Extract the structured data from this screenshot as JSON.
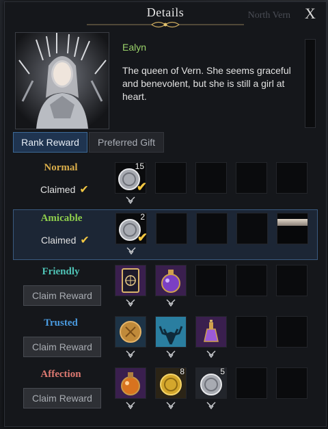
{
  "window": {
    "title": "Details",
    "background_label": "North Vern",
    "close_label": "X"
  },
  "character": {
    "name": "Ealyn",
    "description": "The queen of Vern. She seems graceful and benevolent, but she is still a girl at heart."
  },
  "tabs": [
    {
      "label": "Rank Reward",
      "active": true
    },
    {
      "label": "Preferred Gift",
      "active": false
    }
  ],
  "rows": [
    {
      "rank": "Normal",
      "color": "#d9ad4a",
      "status": "Claimed",
      "claimed": true,
      "rewards": [
        {
          "icon": "silver-coin-icon",
          "qty": "15",
          "claimed": true
        }
      ]
    },
    {
      "rank": "Amicable",
      "color": "#8fcf4c",
      "status": "Claimed",
      "claimed": true,
      "highlighted": true,
      "rewards": [
        {
          "icon": "silver-coin-icon",
          "qty": "2",
          "claimed": true
        }
      ]
    },
    {
      "rank": "Friendly",
      "color": "#4fc3b6",
      "status": "Claim Reward",
      "claimed": false,
      "rewards": [
        {
          "icon": "card-icon",
          "qty": ""
        },
        {
          "icon": "purple-potion-icon",
          "qty": ""
        }
      ]
    },
    {
      "rank": "Trusted",
      "color": "#4a9be0",
      "status": "Claim Reward",
      "claimed": false,
      "rewards": [
        {
          "icon": "rune-coin-icon",
          "qty": ""
        },
        {
          "icon": "stag-emblem-icon",
          "qty": ""
        },
        {
          "icon": "violet-flask-icon",
          "qty": ""
        }
      ]
    },
    {
      "rank": "Affection",
      "color": "#e07a72",
      "status": "Claim Reward",
      "claimed": false,
      "rewards": [
        {
          "icon": "orange-potion-icon",
          "qty": ""
        },
        {
          "icon": "gold-coin-icon",
          "qty": "8"
        },
        {
          "icon": "silver-coin-icon",
          "qty": "5"
        }
      ]
    }
  ]
}
